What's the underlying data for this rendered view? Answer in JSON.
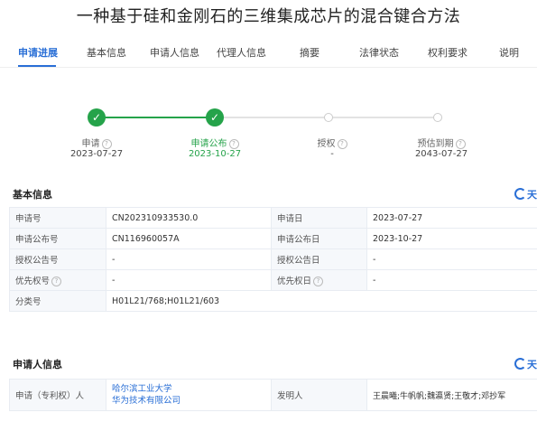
{
  "title": "一种基于硅和金刚石的三维集成芯片的混合键合方法",
  "tabs": [
    "申请进展",
    "基本信息",
    "申请人信息",
    "代理人信息",
    "摘要",
    "法律状态",
    "权利要求",
    "说明"
  ],
  "progress": {
    "steps": [
      {
        "label": "申请",
        "date": "2023-07-27",
        "done": true
      },
      {
        "label": "申请公布",
        "date": "2023-10-27",
        "done": true
      },
      {
        "label": "授权",
        "date": "-",
        "done": false
      },
      {
        "label": "预估到期",
        "date": "2043-07-27",
        "done": false
      }
    ],
    "completed_fraction": 0.5
  },
  "basic": {
    "section_title": "基本信息",
    "brand": "天",
    "rows": [
      {
        "l1": "申请号",
        "v1": "CN202310933530.0",
        "l2": "申请日",
        "v2": "2023-07-27"
      },
      {
        "l1": "申请公布号",
        "v1": "CN116960057A",
        "l2": "申请公布日",
        "v2": "2023-10-27"
      },
      {
        "l1": "授权公告号",
        "v1": "-",
        "l2": "授权公告日",
        "v2": "-"
      },
      {
        "l1": "优先权号",
        "v1": "-",
        "l2": "优先权日",
        "v2": "-"
      }
    ],
    "class_label": "分类号",
    "class_value": "H01L21/768;H01L21/603"
  },
  "applicant": {
    "section_title": "申请人信息",
    "brand": "天",
    "label": "申请（专利权）人",
    "applicants": [
      "哈尔滨工业大学",
      "华为技术有限公司"
    ],
    "inventor_label": "发明人",
    "inventors": "王晨曦;牛帆帆;魏瀛贤;王敬才;邓抄军"
  },
  "colors": {
    "accent": "#2a6fd6",
    "done": "#25a34a",
    "pending": "#cccccc"
  }
}
